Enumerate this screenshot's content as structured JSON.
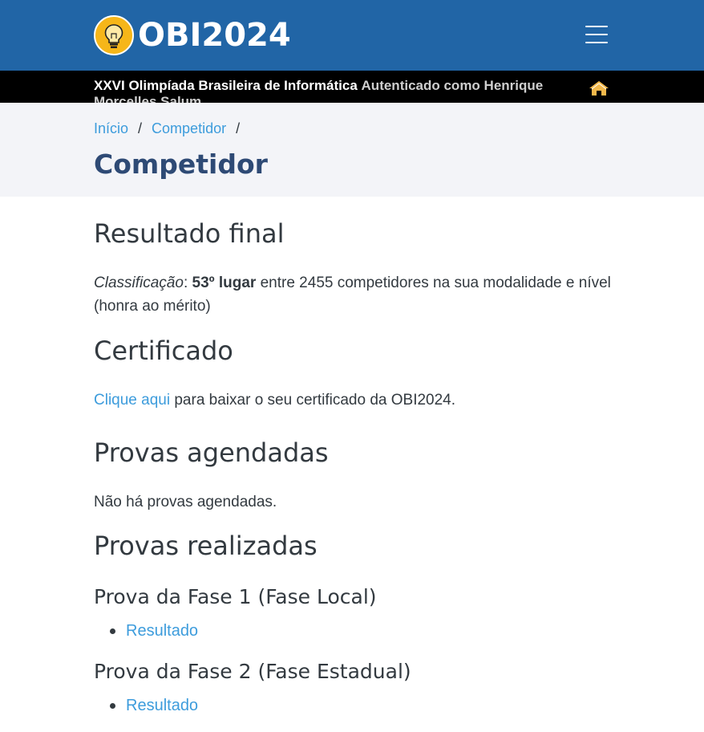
{
  "header": {
    "logo_text": "OBI2024",
    "subtitle": "XXVI Olimpíada Brasileira de Informática",
    "auth_text": "Autenticado como Henrique Morcelles Salum"
  },
  "breadcrumb": {
    "items": [
      "Início",
      "Competidor"
    ],
    "separator": "/"
  },
  "page": {
    "title": "Competidor"
  },
  "resultado_final": {
    "heading": "Resultado final",
    "label": "Classificação",
    "colon": ":",
    "rank": "53º lugar",
    "detail": "entre 2455 competidores na sua modalidade e nível (honra ao mérito)"
  },
  "certificado": {
    "heading": "Certificado",
    "link": "Clique aqui",
    "text": "para baixar o seu certificado da OBI2024."
  },
  "provas_agendadas": {
    "heading": "Provas agendadas",
    "text": "Não há provas agendadas."
  },
  "provas_realizadas": {
    "heading": "Provas realizadas",
    "items": [
      {
        "title": "Prova da Fase 1 (Fase Local)",
        "link": "Resultado"
      },
      {
        "title": "Prova da Fase 2 (Fase Estadual)",
        "link": "Resultado"
      }
    ]
  },
  "icons": {
    "logo": "lightbulb-icon",
    "menu": "hamburger-menu-icon",
    "home": "home-icon"
  },
  "colors": {
    "header_bg": "#2165a6",
    "subbar_bg": "#000000",
    "hero_bg": "#f3f4f8",
    "link": "#3d9cdc",
    "title": "#2e4a75",
    "logo_accent": "#f6b619",
    "home_icon": "#f2b84b"
  }
}
